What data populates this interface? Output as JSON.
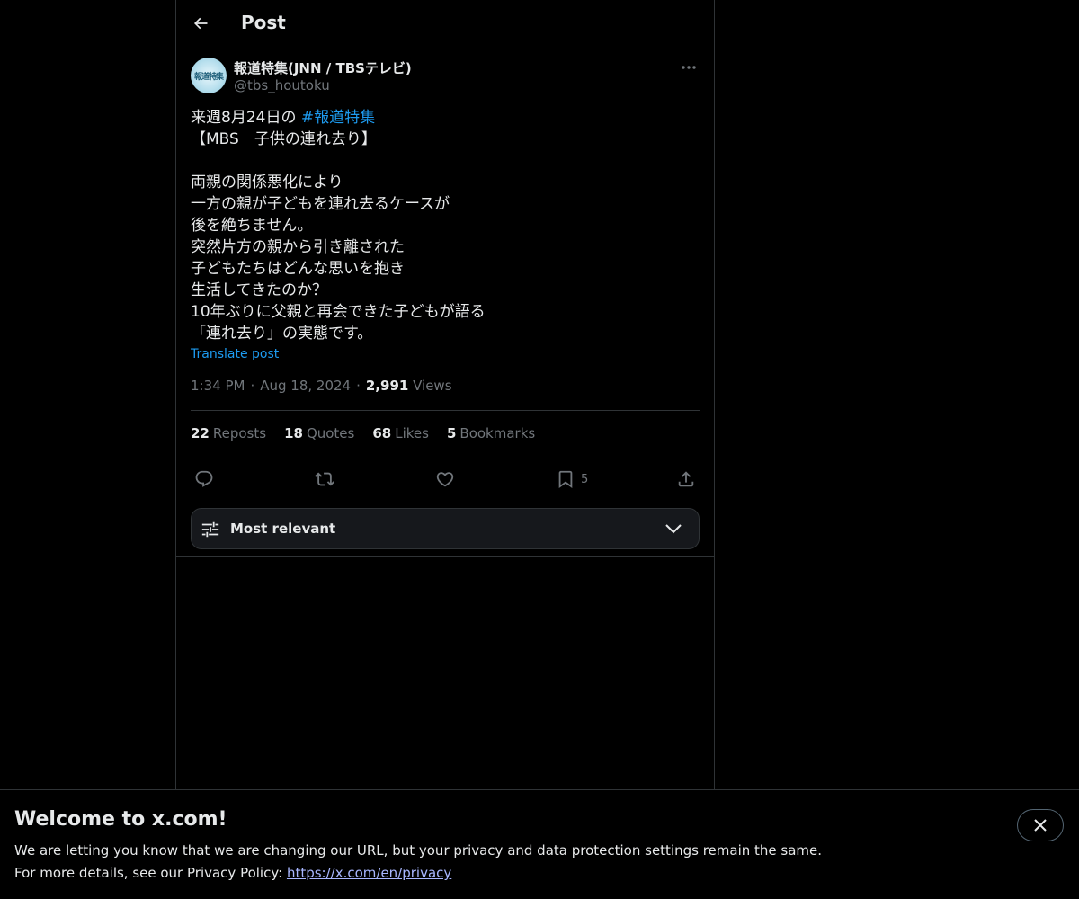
{
  "header": {
    "title": "Post"
  },
  "post": {
    "author": {
      "display_name": "報道特集(JNN / TBSテレビ)",
      "handle": "@tbs_houtoku",
      "avatar_text": "報道特集"
    },
    "text_lines": [
      {
        "prefix": "来週8月24日の ",
        "hashtag": "#報道特集"
      },
      {
        "text": "【MBS　子供の連れ去り】"
      },
      {
        "text": ""
      },
      {
        "text": "両親の関係悪化により"
      },
      {
        "text": "一方の親が子どもを連れ去るケースが"
      },
      {
        "text": "後を絶ちません。"
      },
      {
        "text": "突然片方の親から引き離された"
      },
      {
        "text": "子どもたちはどんな思いを抱き"
      },
      {
        "text": "生活してきたのか？"
      },
      {
        "text": "10年ぶりに父親と再会できた子どもが語る"
      },
      {
        "text": "「連れ去り」の実態です。"
      }
    ],
    "translate_label": "Translate post",
    "time": "1:34 PM",
    "date": "Aug 18, 2024",
    "views_count": "2,991",
    "views_label": "Views",
    "separator": "·"
  },
  "stats": {
    "reposts_count": "22",
    "reposts_label": "Reposts",
    "quotes_count": "18",
    "quotes_label": "Quotes",
    "likes_count": "68",
    "likes_label": "Likes",
    "bookmarks_count": "5",
    "bookmarks_label": "Bookmarks"
  },
  "actions": {
    "bookmark_count": "5"
  },
  "sort": {
    "label": "Most relevant"
  },
  "banner": {
    "title": "Welcome to x.com!",
    "line1": "We are letting you know that we are changing our URL, but your privacy and data protection settings remain the same.",
    "line2_prefix": "For more details, see our Privacy Policy: ",
    "link": "https://x.com/en/privacy"
  },
  "colors": {
    "background": "#000000",
    "text": "#e7e9ea",
    "muted": "#71767b",
    "accent": "#1d9bf0",
    "border": "#2f3336"
  }
}
